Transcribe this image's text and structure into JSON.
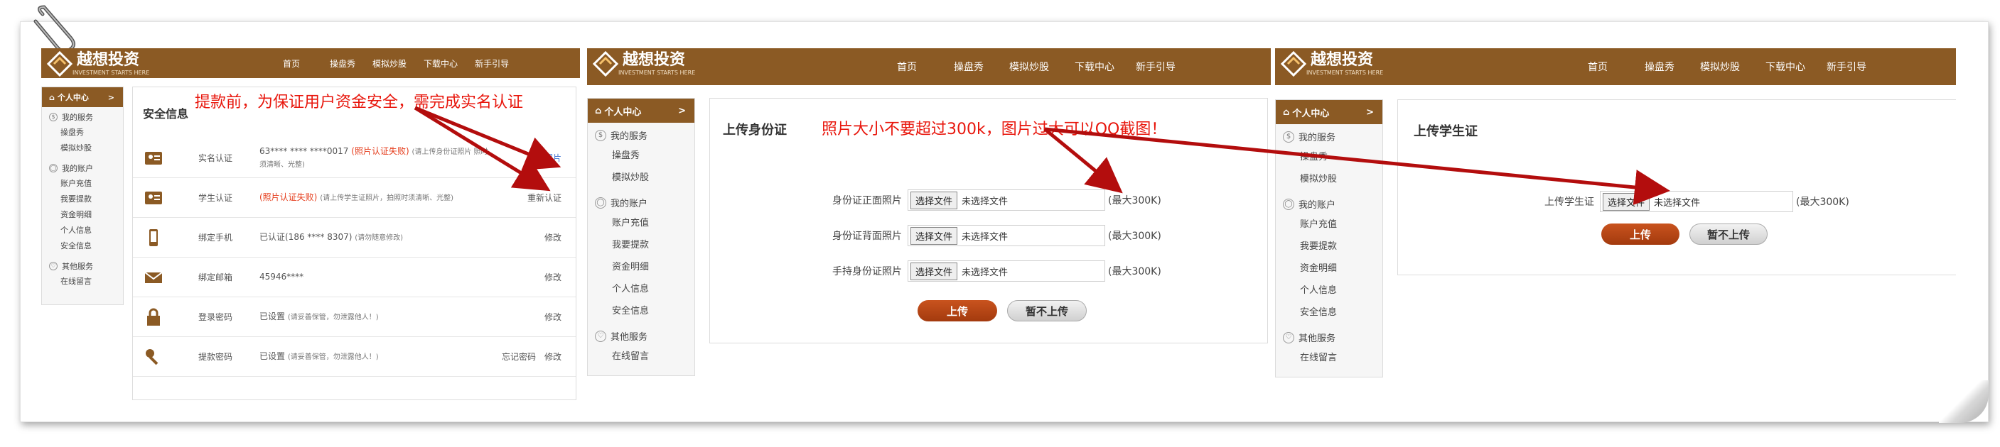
{
  "brand": {
    "name": "越想投资",
    "tagline": "INVESTMENT STARTS HERE"
  },
  "nav": [
    "首页",
    "操盘秀",
    "模拟炒股",
    "下载中心",
    "新手引导"
  ],
  "sidebar": {
    "header": "个人中心",
    "header_arrow": ">",
    "groups": [
      {
        "title": "我的服务",
        "icon": "dollar-circle-icon",
        "items": [
          "操盘秀",
          "模拟炒股"
        ]
      },
      {
        "title": "我的账户",
        "icon": "user-icon",
        "items": [
          "账户充值",
          "我要提款",
          "资金明细",
          "个人信息",
          "安全信息"
        ]
      },
      {
        "title": "其他服务",
        "icon": "heart-icon",
        "items": [
          "在线留言"
        ]
      }
    ]
  },
  "annotations": {
    "note1": "提款前，为保证用户资金安全，需完成实名认证",
    "note2": "照片大小不要超过300k，图片过大可以QQ截图！"
  },
  "panel1": {
    "title": "安全信息",
    "rows": [
      {
        "label": "实名认证",
        "value": "63**** **** ****0017",
        "status": "(照片认证失败)",
        "hint": "(请上传身份证照片 照时须清晰、光整)",
        "action": "上传照片",
        "icon": "id-card-icon"
      },
      {
        "label": "学生认证",
        "status": "(照片认证失败)",
        "hint": "(请上传学生证照片，拍照时须清晰、光整)",
        "action": "重新认证",
        "icon": "student-card-icon"
      },
      {
        "label": "绑定手机",
        "value": "已认证(186 **** 8307)",
        "hint": "(请勿随意修改)",
        "action": "修改",
        "icon": "phone-icon"
      },
      {
        "label": "绑定邮箱",
        "value": "45946****",
        "action": "修改",
        "icon": "mail-icon"
      },
      {
        "label": "登录密码",
        "value": "已设置",
        "hint": "(请妥善保管，勿泄露他人！)",
        "action": "修改",
        "icon": "lock-icon"
      },
      {
        "label": "提款密码",
        "value": "已设置",
        "hint": "(请妥善保管，勿泄露他人！)",
        "action": "修改",
        "action2": "忘记密码",
        "icon": "key-icon"
      }
    ]
  },
  "panel2": {
    "title": "上传身份证",
    "fields": [
      {
        "label": "身份证正面照片"
      },
      {
        "label": "身份证背面照片"
      },
      {
        "label": "手持身份证照片"
      }
    ],
    "file_button": "选择文件",
    "file_none": "未选择文件",
    "max_size": "(最大300K)",
    "upload_label": "上传",
    "skip_label": "暂不上传"
  },
  "panel3": {
    "title": "上传学生证",
    "fields": [
      {
        "label": "上传学生证"
      }
    ],
    "file_button": "选择文件",
    "file_none": "未选择文件",
    "max_size": "(最大300K)",
    "upload_label": "上传",
    "skip_label": "暂不上传"
  },
  "colors": {
    "brand_brown": "#8b5a24",
    "alert_red": "#e53c1b",
    "arrow_red": "#b30d0d",
    "upload_btn": "#b9461a"
  }
}
